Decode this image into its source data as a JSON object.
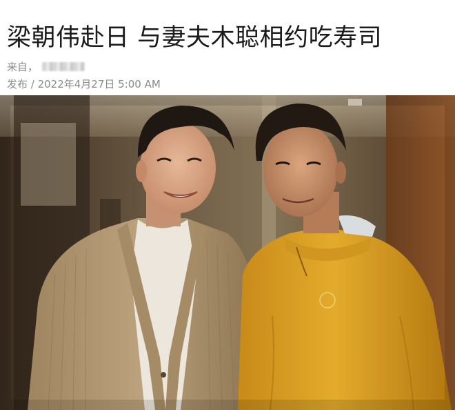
{
  "article": {
    "title": "梁朝伟赴日 与妻夫木聪相约吃寿司",
    "source_label": "来自，",
    "publish_label": "发布 / 2022年4月27日 5:00 AM"
  },
  "photo": {
    "watermark_mark": "ᚿ"
  },
  "colors": {
    "text": "#1a1a1a",
    "meta": "#8a8a8a",
    "cardigan": "#b69a73",
    "jacket": "#e0a626"
  }
}
